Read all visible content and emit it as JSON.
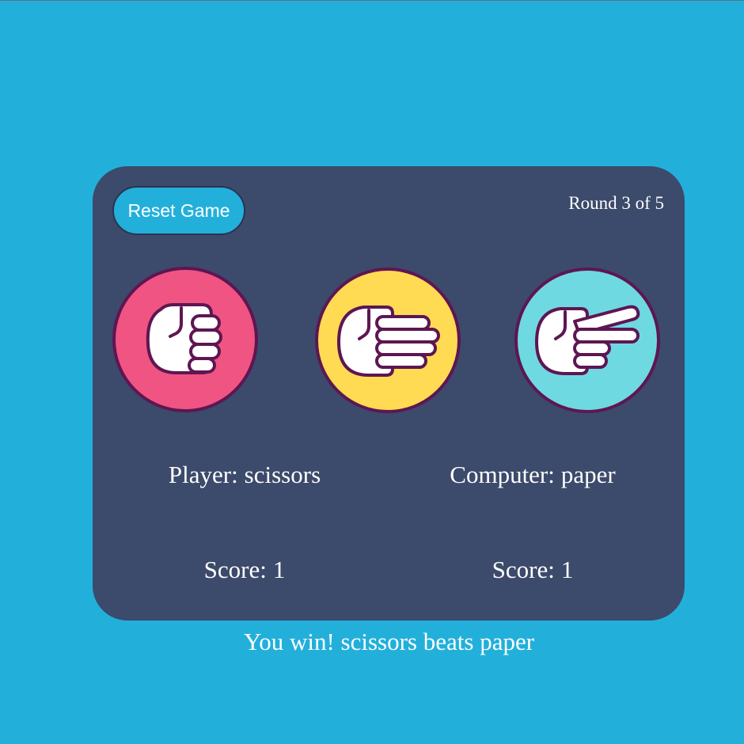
{
  "header": {
    "reset_label": "Reset Game",
    "round_text": "Round 3 of 5"
  },
  "choices": [
    {
      "name": "rock",
      "icon": "fist-icon",
      "color": "#f05483"
    },
    {
      "name": "paper",
      "icon": "open-hand-icon",
      "color": "#fedb52"
    },
    {
      "name": "scissors",
      "icon": "scissors-hand-icon",
      "color": "#6fd9e1"
    }
  ],
  "player": {
    "label": "Player:",
    "choice": "scissors",
    "score_label": "Score:",
    "score": "1"
  },
  "computer": {
    "label": "Computer:",
    "choice": "paper",
    "score_label": "Score:",
    "score": "1"
  },
  "result": "You win! scissors beats paper",
  "colors": {
    "background": "#22b0db",
    "card": "#3c4a6b",
    "outline": "#5e1652"
  }
}
